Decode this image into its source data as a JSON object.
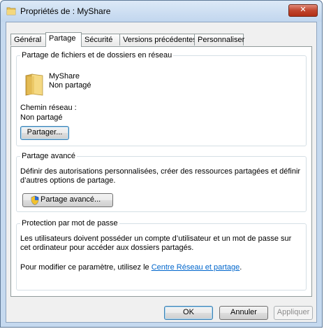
{
  "window": {
    "title": "Propriétés de : MyShare",
    "close_symbol": "✕"
  },
  "tabs": [
    {
      "label": "Général"
    },
    {
      "label": "Partage"
    },
    {
      "label": "Sécurité"
    },
    {
      "label": "Versions précédentes"
    },
    {
      "label": "Personnaliser"
    }
  ],
  "network_sharing": {
    "title": "Partage de fichiers et de dossiers en réseau",
    "folder_name": "MyShare",
    "folder_status": "Non partagé",
    "network_path_label": "Chemin réseau :",
    "network_path_value": "Non partagé",
    "share_button": "Partager..."
  },
  "advanced_sharing": {
    "title": "Partage avancé",
    "description_line1": "Définir des autorisations personnalisées, créer des ressources partagées et définir",
    "description_line2": "d’autres options de partage.",
    "button": "Partage avancé..."
  },
  "password_protection": {
    "title": "Protection par mot de passe",
    "line1": "Les utilisateurs doivent posséder un compte d’utilisateur et un mot de passe sur",
    "line2": "cet ordinateur pour accéder aux dossiers partagés.",
    "modify_prefix": "Pour modifier ce paramètre, utilisez le ",
    "modify_link": "Centre Réseau et partage",
    "modify_suffix": "."
  },
  "footer": {
    "ok": "OK",
    "cancel": "Annuler",
    "apply": "Appliquer"
  },
  "colors": {
    "link": "#0066cc",
    "close_button": "#c0452d"
  }
}
